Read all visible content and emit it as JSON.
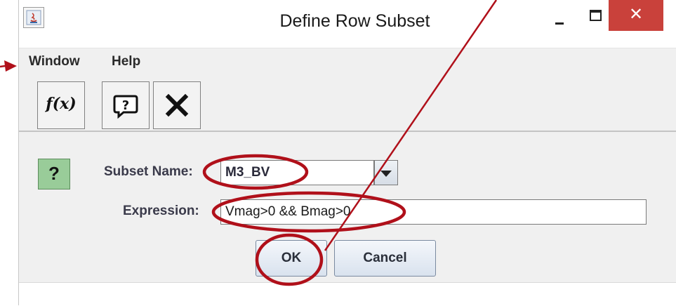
{
  "window": {
    "title": "Define Row Subset",
    "close_glyph": "✕"
  },
  "menu": {
    "window_label": "Window",
    "help_label": "Help"
  },
  "toolbar": {
    "fx_label": "f(x)"
  },
  "form": {
    "help_glyph": "?",
    "subset_name_label": "Subset Name:",
    "subset_name_value": "M3_BV",
    "expression_label": "Expression:",
    "expression_value": "Vmag>0 && Bmag>0",
    "ok_label": "OK",
    "cancel_label": "Cancel"
  },
  "annotations": {
    "color": "#b0101a"
  },
  "icons": [
    "java-app-icon",
    "minimize-icon",
    "maximize-icon",
    "close-icon",
    "function-icon",
    "help-speech-icon",
    "close-x-icon",
    "question-icon",
    "dropdown-arrow-icon"
  ]
}
